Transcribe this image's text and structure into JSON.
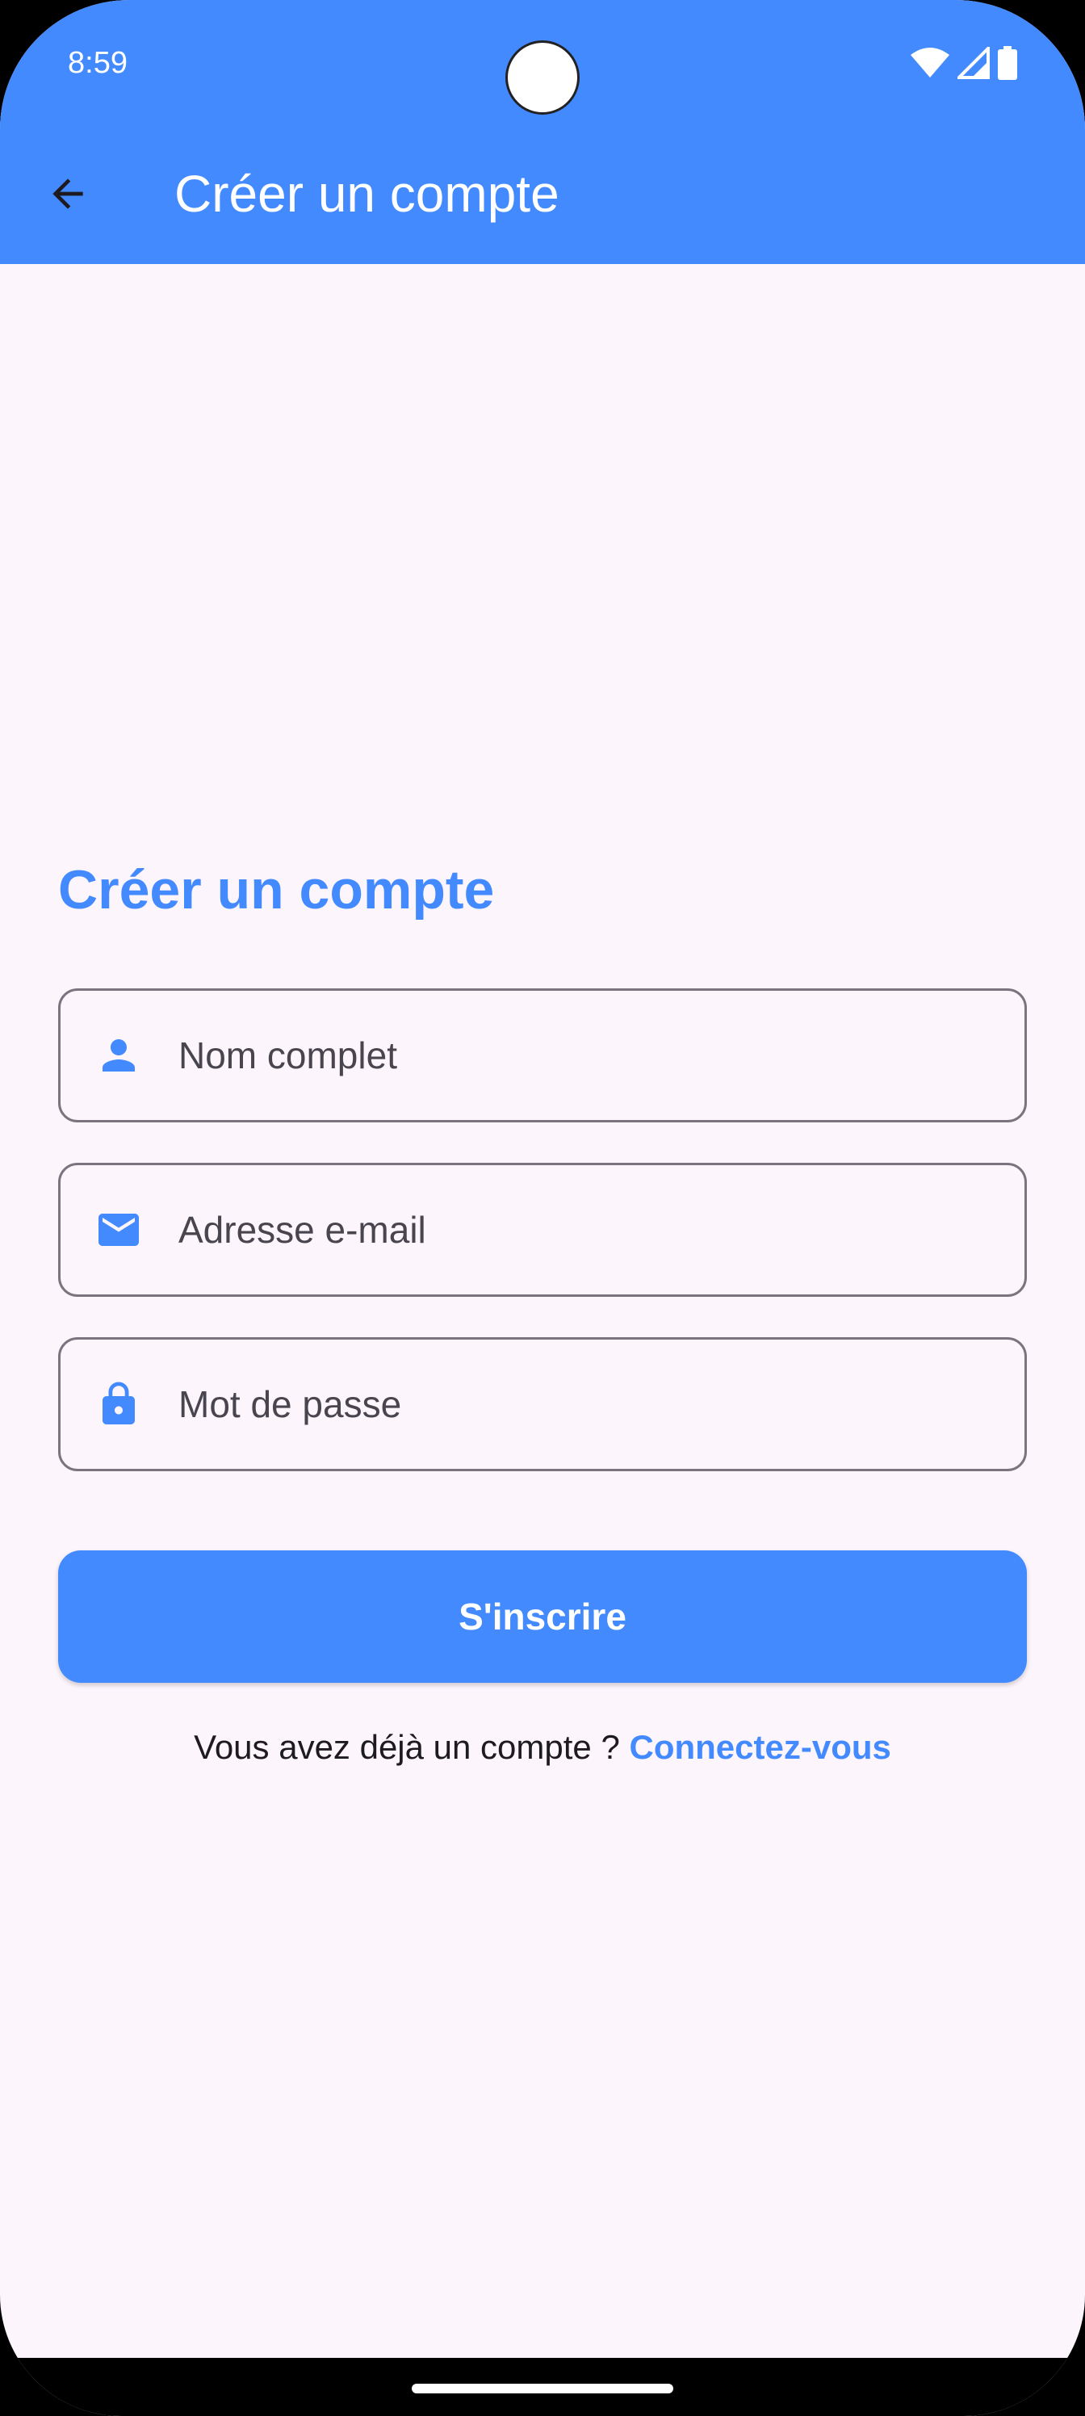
{
  "status_bar": {
    "time": "8:59",
    "icons": [
      "wifi-icon",
      "cell-signal-icon",
      "battery-icon"
    ]
  },
  "app_bar": {
    "back_icon": "arrow-back-icon",
    "title": "Créer un compte"
  },
  "form": {
    "heading": "Créer un compte",
    "fields": {
      "name": {
        "icon": "person-icon",
        "placeholder": "Nom complet",
        "value": ""
      },
      "email": {
        "icon": "mail-icon",
        "placeholder": "Adresse e-mail",
        "value": ""
      },
      "password": {
        "icon": "lock-icon",
        "placeholder": "Mot de passe",
        "value": ""
      }
    },
    "submit_label": "S'inscrire",
    "login_prompt": "Vous avez déjà un compte ? ",
    "login_link": "Connectez-vous"
  },
  "colors": {
    "primary": "#448aff",
    "background": "#fcf5fc",
    "outline": "#79747e",
    "text": "#1d1b20"
  }
}
